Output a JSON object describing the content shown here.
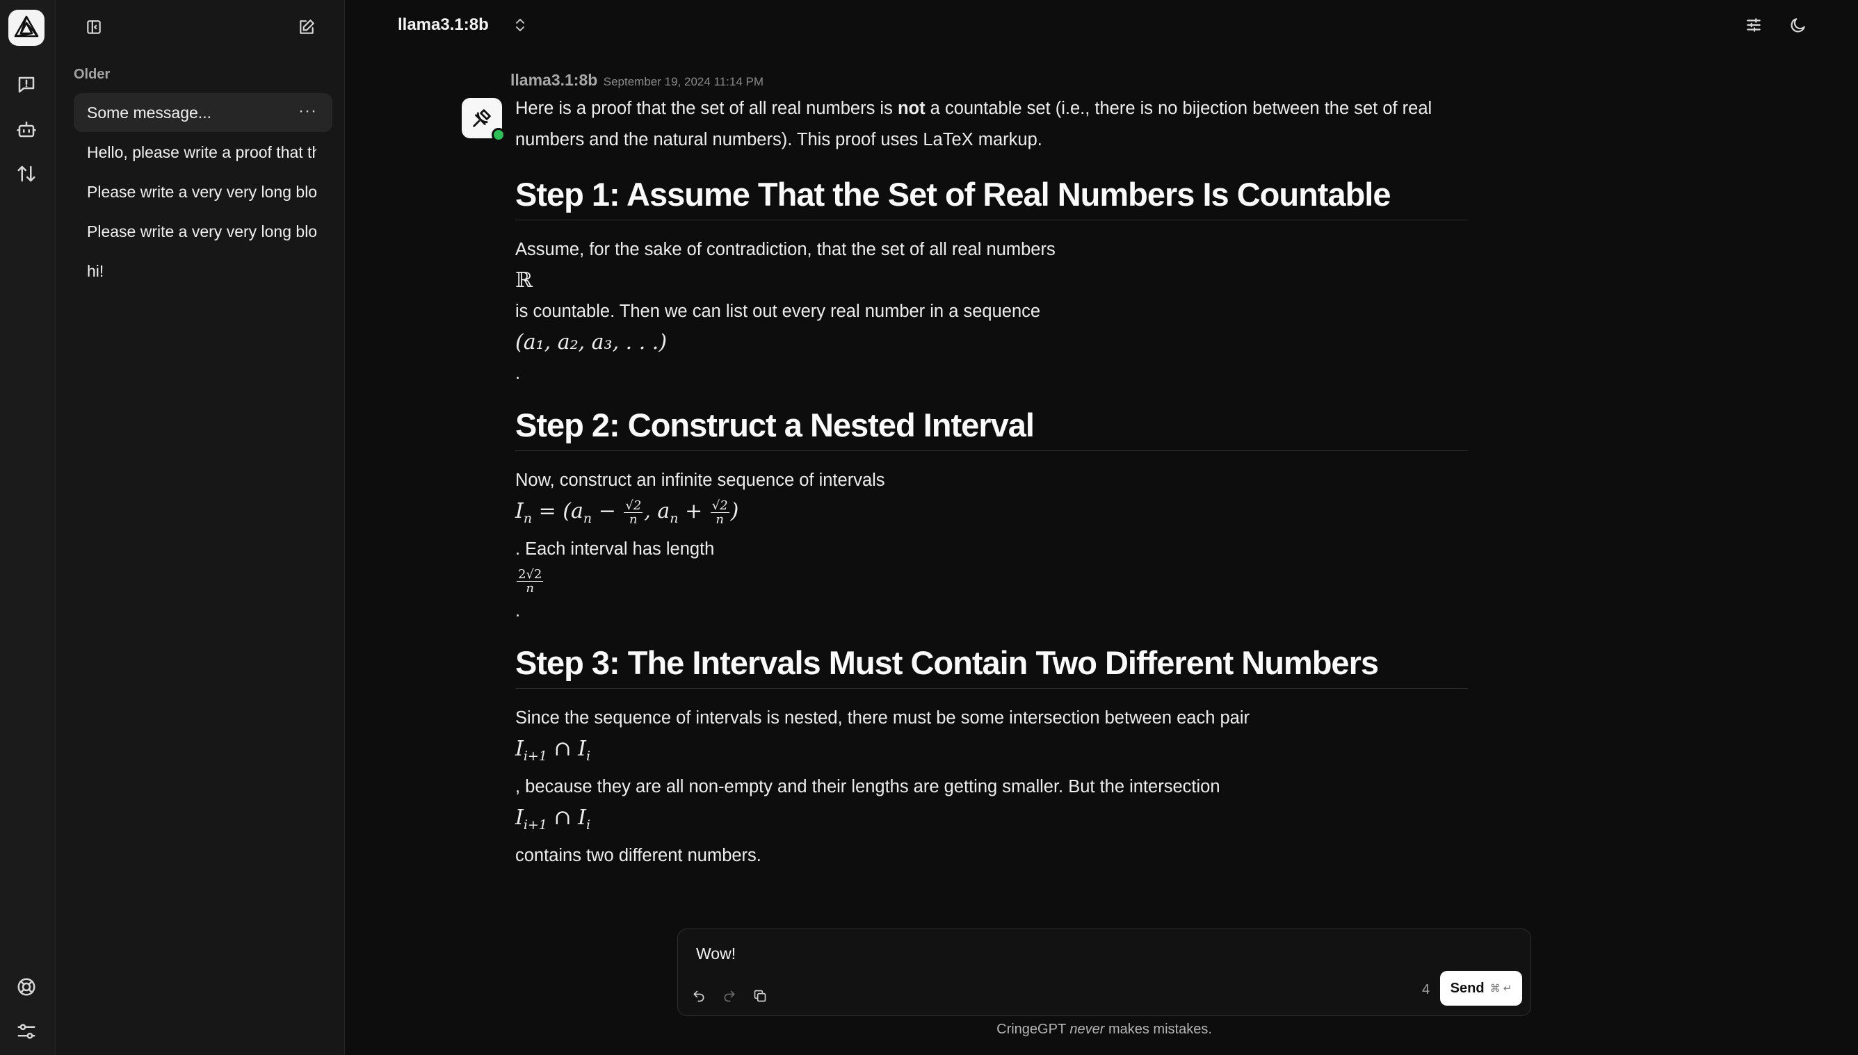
{
  "app": {
    "brand": "CringeGPT"
  },
  "sidebar": {
    "section_label": "Older",
    "chats": [
      {
        "label": "Some message...",
        "active": true
      },
      {
        "label": "Hello, please write a proof that the set of all real numbers is not countable",
        "active": false
      },
      {
        "label": "Please write a very very long blog post",
        "active": false
      },
      {
        "label": "Please write a very very long blog post",
        "active": false
      },
      {
        "label": "hi!",
        "active": false
      }
    ],
    "more_glyph": "···"
  },
  "header": {
    "model": "llama3.1:8b"
  },
  "message": {
    "author": "llama3.1:8b",
    "timestamp": "September 19, 2024 11:14 PM",
    "intro_before": "Here is a proof that the set of all real numbers is ",
    "intro_bold": "not",
    "intro_after": " a countable set (i.e., there is no bijection between the set of real numbers and the natural numbers). This proof uses LaTeX markup.",
    "step1": {
      "heading": "Step 1: Assume That the Set of Real Numbers Is Countable",
      "line1": "Assume, for the sake of contradiction, that the set of all real numbers",
      "math1": "ℝ",
      "line2": "is countable. Then we can list out every real number in a sequence",
      "math2": "(a₁, a₂, a₃, . . .)",
      "line3": "."
    },
    "step2": {
      "heading": "Step 2: Construct a Nested Interval",
      "line1": "Now, construct an infinite sequence of intervals",
      "line2": ". Each interval has length",
      "line3": "."
    },
    "step3": {
      "heading": "Step 3: The Intervals Must Contain Two Different Numbers",
      "line1": "Since the sequence of intervals is nested, there must be some intersection between each pair",
      "line2": ", because they are all non-empty and their lengths are getting smaller. But the intersection",
      "line3": "contains two different numbers."
    }
  },
  "composer": {
    "value": "Wow!",
    "char_count": "4",
    "send_label": "Send",
    "send_shortcut": "⌘ ↵"
  },
  "footer": {
    "before": "CringeGPT ",
    "emph": "never",
    "after": " makes mistakes."
  },
  "colors": {
    "background": "#0d0d0d",
    "sidebar": "#171717",
    "rail": "#1b1b1b",
    "online": "#2fbf59"
  },
  "icons": [
    "logo-icon",
    "chat-icon",
    "bot-icon",
    "sort-icon",
    "help-icon",
    "settings-icon",
    "sidebar-toggle-icon",
    "new-chat-icon",
    "chevron-updown-icon",
    "sliders-icon",
    "moon-icon",
    "undo-icon",
    "redo-icon",
    "copy-icon",
    "model-avatar-icon"
  ]
}
